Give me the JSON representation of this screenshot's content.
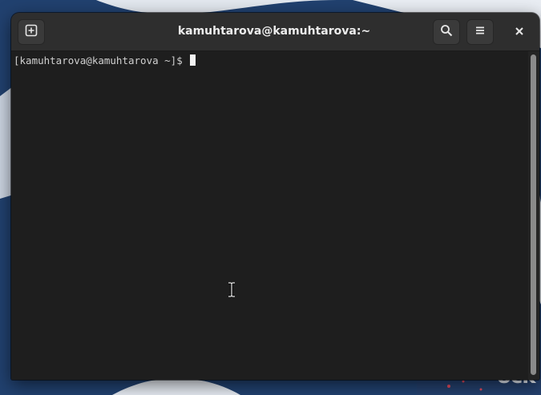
{
  "desktop": {
    "wallpaper_text": "ock",
    "accent_color": "#1f3c68"
  },
  "window": {
    "title": "kamuhtarova@kamuhtarova:~",
    "buttons": {
      "new_tab": "new-tab-icon",
      "search": "search-icon",
      "menu": "hamburger-menu-icon",
      "close": "close-icon"
    }
  },
  "terminal": {
    "prompt": "[kamuhtarova@kamuhtarova ~]$ ",
    "background_color": "#1e1e1e",
    "foreground_color": "#d0d0d0"
  }
}
